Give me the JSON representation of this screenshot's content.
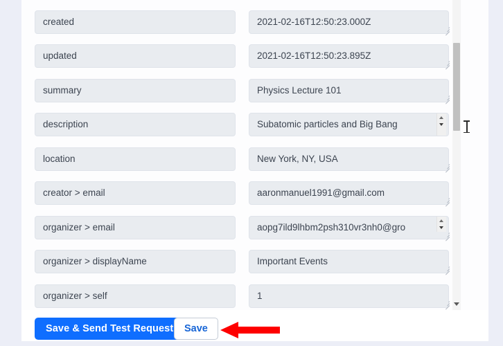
{
  "form": {
    "rows": [
      {
        "key": "created",
        "value": "2021-02-16T12:50:23.000Z"
      },
      {
        "key": "updated",
        "value": "2021-02-16T12:50:23.895Z"
      },
      {
        "key": "summary",
        "value": "Physics Lecture 101"
      },
      {
        "key": "description",
        "value": "Subatomic particles and Big Bang"
      },
      {
        "key": "location",
        "value": "New York, NY, USA"
      },
      {
        "key": "creator > email",
        "value": "aaronmanuel1991@gmail.com"
      },
      {
        "key": "organizer > email",
        "value": "aopg7ild9lhbm2psh310vr3nh0@gro"
      },
      {
        "key": "organizer > displayName",
        "value": "Important Events"
      },
      {
        "key": "organizer > self",
        "value": "1"
      }
    ]
  },
  "footer": {
    "primary_label": "Save & Send Test Request",
    "secondary_label": "Save"
  },
  "colors": {
    "primary_button": "#0f6eff",
    "secondary_text": "#1765d6",
    "field_bg": "#e9ecf0",
    "page_bg": "#eceef7",
    "annotation_arrow": "#fe0000",
    "scrollbar_thumb": "#c0c0c0"
  },
  "icons": {
    "resize_grip": "resize-grip-icon",
    "scroll_up": "scroll-up-arrow-icon",
    "scroll_down": "scroll-down-arrow-icon",
    "text_cursor": "text-cursor-icon",
    "annotation": "left-pointing-arrow-annotation"
  }
}
